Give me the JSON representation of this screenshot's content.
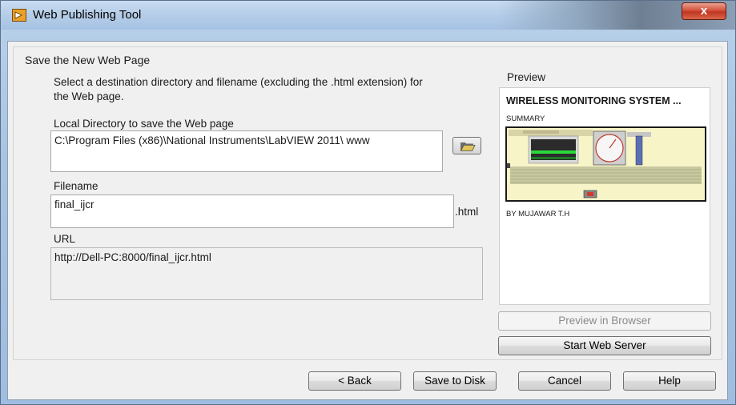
{
  "window": {
    "title": "Web Publishing Tool",
    "close_glyph": "x",
    "icon": "labview-icon"
  },
  "section": {
    "title": "Save the New Web Page"
  },
  "instructions": "Select a destination directory and filename (excluding the .html extension) for the Web page.",
  "local_directory": {
    "label": "Local Directory to save the Web page",
    "value": "C:\\Program Files (x86)\\National Instruments\\LabVIEW 2011\\ www",
    "browse_icon": "folder-open-icon"
  },
  "filename": {
    "label": "Filename",
    "value": "final_ijcr",
    "suffix": ".html"
  },
  "url": {
    "label": "URL",
    "value": "http://Dell-PC:8000/final_ijcr.html"
  },
  "preview": {
    "label": "Preview",
    "page_title": "WIRELESS MONITORING SYSTEM ...",
    "summary": "SUMMARY",
    "byline": "BY MUJAWAR T.H",
    "preview_in_browser_label": "Preview in Browser",
    "start_web_server_label": "Start Web Server"
  },
  "footer": {
    "back_label": "< Back",
    "save_label": "Save to Disk",
    "cancel_label": "Cancel",
    "help_label": "Help"
  },
  "colors": {
    "titlebar": "#b5cde8",
    "close_button": "#c0361f",
    "dialog_bg": "#f0f0f0",
    "preview_panel_bg": "#f7f4c8",
    "preview_bar_green": "#2bd93a"
  }
}
